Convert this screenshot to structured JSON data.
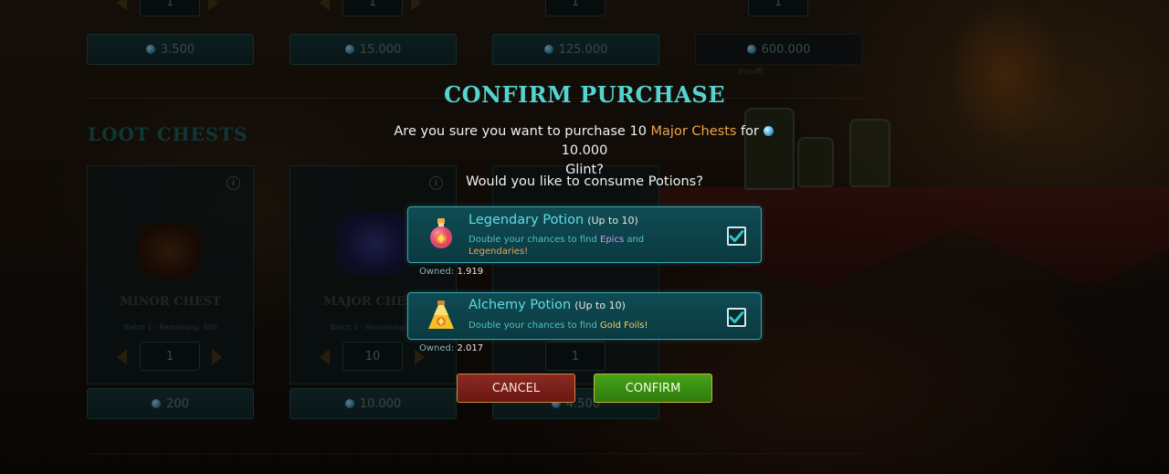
{
  "background": {
    "section_title": "LOOT CHESTS",
    "top_row_prices": [
      "3.500",
      "15.000",
      "125.000",
      "600.000"
    ],
    "top_row_qty": [
      "1",
      "1",
      "1",
      "1"
    ],
    "insufficient_hint": "Insuffi",
    "cards": [
      {
        "name": "MINOR CHEST",
        "batch": "Batch 1 - Remaining: 300",
        "qty": "1",
        "price": "200"
      },
      {
        "name": "MAJOR CHEST",
        "batch": "Batch 1 - Remaining: ...",
        "qty": "10",
        "price": "10.000"
      },
      {
        "name": "",
        "batch": "",
        "qty": "1",
        "price": "4.500"
      }
    ],
    "info_icon": "i"
  },
  "modal": {
    "title": "CONFIRM PURCHASE",
    "question_prefix": "Are you sure you want to purchase 10 ",
    "question_item": "Major Chests",
    "question_mid": " for ",
    "question_amount": "10.000",
    "question_suffix": "Glint?",
    "sub_question": "Would you like to consume Potions?",
    "potions": [
      {
        "name": "Legendary Potion",
        "limit": "(Up to 10)",
        "desc_prefix": "Double your chances to find ",
        "desc_hl1": "Epics",
        "desc_mid": " and ",
        "desc_hl2": "Legendaries!",
        "owned_label": "Owned:",
        "owned_value": "1.919",
        "checked": true
      },
      {
        "name": "Alchemy Potion",
        "limit": "(Up to 10)",
        "desc_prefix": "Double your chances to find ",
        "desc_hl": "Gold Foils!",
        "owned_label": "Owned:",
        "owned_value": "2.017",
        "checked": true
      }
    ],
    "cancel_label": "CANCEL",
    "confirm_label": "CONFIRM"
  },
  "colors": {
    "title": "#54d3cf",
    "potion_name": "#60dde0",
    "highlight_orange": "#f2a24a",
    "highlight_purple": "#c79af2",
    "highlight_gold": "#f2d25a",
    "cancel_bg": "#7a1f1a",
    "confirm_bg": "#3a8f12"
  }
}
